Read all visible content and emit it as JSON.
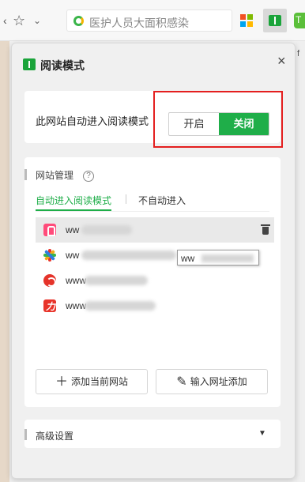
{
  "browser": {
    "search_text": "医护人员大面积感染",
    "right_edge_text": "f",
    "ext_label": "T"
  },
  "panel": {
    "title": "阅读模式",
    "close": "×"
  },
  "auto_mode": {
    "label": "此网站自动进入阅读模式",
    "on_label": "开启",
    "off_label": "关闭",
    "selected": "off",
    "active_color": "#1fae49",
    "highlight_color": "#e41f1f"
  },
  "site_management": {
    "title": "网站管理",
    "help": "?",
    "tabs": [
      {
        "label": "自动进入阅读模式",
        "active": true
      },
      {
        "label": "不自动进入",
        "active": false
      }
    ],
    "sites": [
      {
        "url": "ww",
        "icon": "pink-reader-icon",
        "hovered": true
      },
      {
        "url": "ww",
        "icon": "colorful-star-icon",
        "hovered": false
      },
      {
        "url": "www",
        "icon": "red-swirl-icon",
        "hovered": false
      },
      {
        "url": "www",
        "icon": "dj-red-icon",
        "hovered": false
      }
    ],
    "tooltip": "ww",
    "add_current": "添加当前网站",
    "add_url": "输入网址添加"
  },
  "advanced": {
    "title": "高级设置",
    "caret": "▼"
  }
}
